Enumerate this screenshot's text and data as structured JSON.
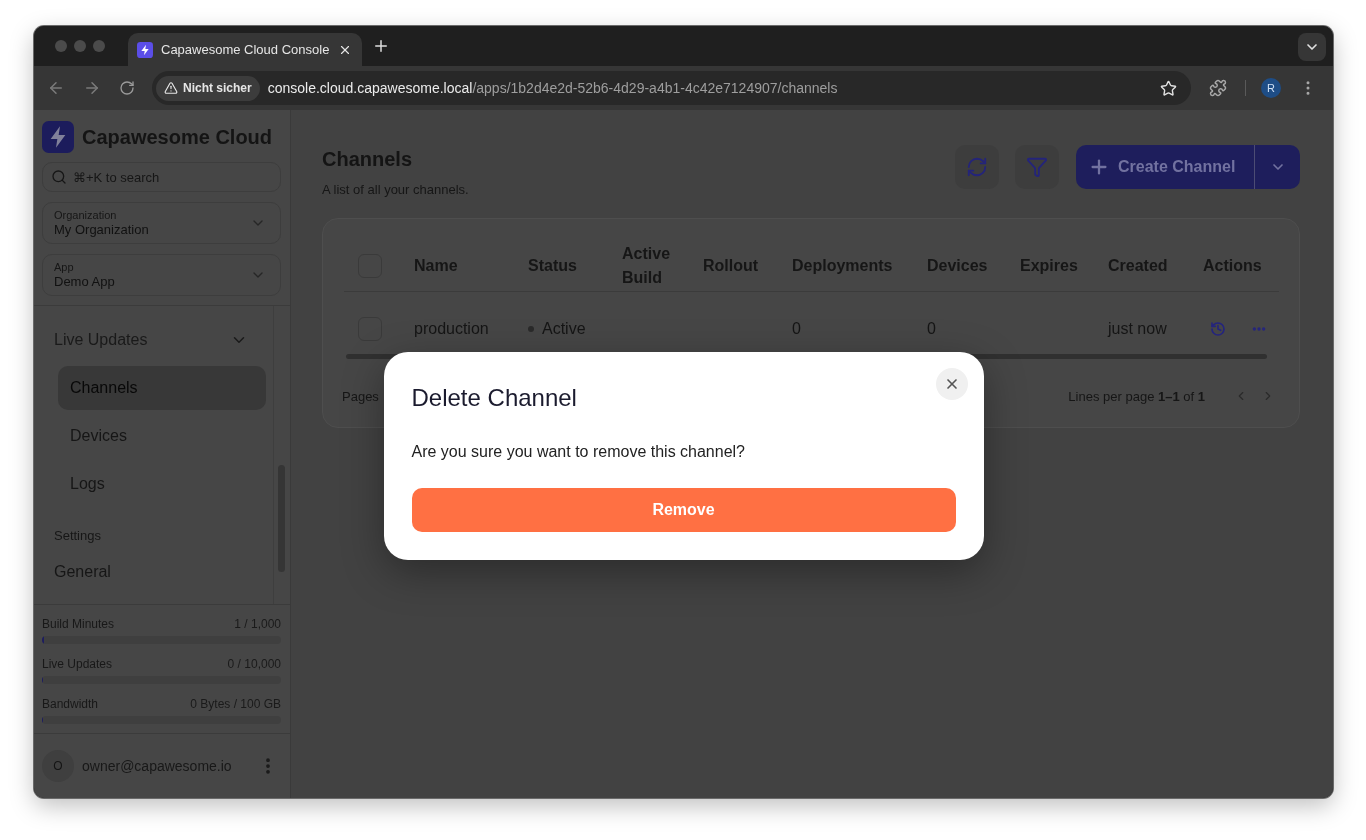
{
  "browser": {
    "tab": {
      "title": "Capawesome Cloud Console",
      "selected": true
    },
    "security_chip": "Nicht sicher",
    "url": {
      "host": "console.cloud.capawesome.local",
      "path": "/apps/1b2d4e2d-52b6-4d29-a4b1-4c42e7124907/channels"
    },
    "profile_initial": "R"
  },
  "sidebar": {
    "brand": "Capawesome Cloud",
    "search": {
      "placeholder": "⌘+K to search"
    },
    "selects": [
      {
        "label": "Organization",
        "value": "My Organization"
      },
      {
        "label": "App",
        "value": "Demo App"
      }
    ],
    "nav": [
      {
        "kind": "group",
        "label": "Live Updates",
        "expanded": true,
        "children": [
          {
            "label": "Channels",
            "selected": true
          },
          {
            "label": "Devices",
            "selected": false
          },
          {
            "label": "Logs",
            "selected": false
          }
        ]
      },
      {
        "kind": "section",
        "label": "Settings",
        "children": [
          {
            "label": "General",
            "selected": false
          }
        ]
      }
    ],
    "usage": [
      {
        "label": "Build Minutes",
        "reading": "1 / 1,000",
        "level": 0.01
      },
      {
        "label": "Live Updates",
        "reading": "0 / 10,000",
        "level": 0
      },
      {
        "label": "Bandwidth",
        "reading": "0 Bytes / 100 GB",
        "level": 0
      }
    ],
    "user": {
      "initial": "O",
      "email": "owner@capawesome.io"
    }
  },
  "page": {
    "title": "Channels",
    "subtitle": "A list of all your channels.",
    "create_button": "Create Channel"
  },
  "table": {
    "all_checked": false,
    "columns": [
      "Name",
      "Status",
      "Active Build",
      "Rollout",
      "Deployments",
      "Devices",
      "Expires",
      "Created",
      "Actions"
    ],
    "rows": [
      {
        "checked": false,
        "name": "production",
        "status": "Active",
        "deployments": "0",
        "devices": "0",
        "created": "just now"
      }
    ],
    "footer": {
      "pages": "Pages",
      "summary": "Lines per page **1–1** of **1**"
    }
  },
  "modal": {
    "title": "Delete Channel",
    "message": "Are you sure you want to remove this channel?",
    "confirm_button": "Remove"
  }
}
